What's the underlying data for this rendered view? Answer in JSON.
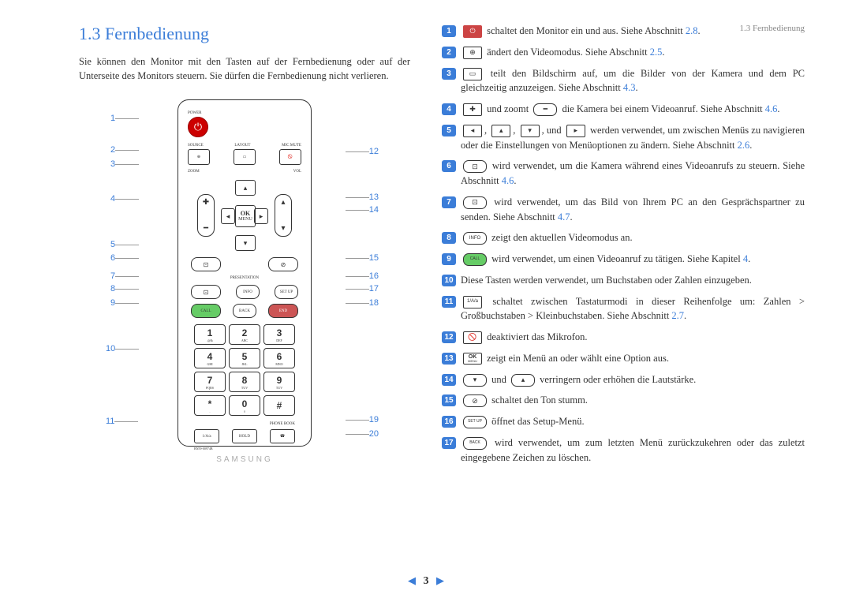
{
  "header": {
    "running": "1.3 Fernbedienung"
  },
  "heading": "1.3    Fernbedienung",
  "intro": "Sie können den Monitor mit den Tasten auf der Fernbedienung oder auf der Unterseite des Monitors steuern. Sie dürfen die Fernbedienung nicht verlieren.",
  "remote": {
    "power_label": "POWER",
    "row1": {
      "source": "SOURCE",
      "layout": "LAYOUT",
      "micmute": "MIC MUTE"
    },
    "zoom": "ZOOM",
    "vol": "VOL",
    "ok_top": "OK",
    "ok_bottom": "MENU",
    "presentation": "PRESENTATION",
    "info": "INFO",
    "setup": "SET UP",
    "call": "CALL",
    "back": "BACK",
    "end": "END",
    "keys": [
      {
        "n": "1",
        "t": ".@&"
      },
      {
        "n": "2",
        "t": "ABC"
      },
      {
        "n": "3",
        "t": "DEF"
      },
      {
        "n": "4",
        "t": "GHI"
      },
      {
        "n": "5",
        "t": "JKL"
      },
      {
        "n": "6",
        "t": "MNO"
      },
      {
        "n": "7",
        "t": "PQRS"
      },
      {
        "n": "8",
        "t": "TUV"
      },
      {
        "n": "9",
        "t": "TUV"
      },
      {
        "n": "*",
        "t": "."
      },
      {
        "n": "0",
        "t": "◊"
      },
      {
        "n": "#",
        "t": ""
      }
    ],
    "phonebook": "PHONE BOOK",
    "mode_key": "1/A/a",
    "hold": "HOLD",
    "bn": "BN59-00974B",
    "logo": "SAMSUNG"
  },
  "callouts_left": [
    "1",
    "2",
    "3",
    "4",
    "5",
    "6",
    "7",
    "8",
    "9",
    "10",
    "11"
  ],
  "callouts_right": [
    "12",
    "13",
    "14",
    "15",
    "16",
    "17",
    "18",
    "19",
    "20"
  ],
  "items": {
    "i1": {
      "icon": "⏻",
      "text": " schaltet den Monitor ein und aus. Siehe Abschnitt ",
      "link": "2.8",
      "suffix": "."
    },
    "i2": {
      "icon": "⊕",
      "text": " ändert den Videomodus. Siehe Abschnitt ",
      "link": "2.5",
      "suffix": "."
    },
    "i3": {
      "icon": "▭",
      "text": " teilt den Bildschirm auf, um die Bilder von der Kamera und dem PC gleichzeitig anzuzeigen. Siehe Abschnitt ",
      "link": "4.3",
      "suffix": "."
    },
    "i4": {
      "plus": "✚",
      "mid": " und zoomt ",
      "minus": "━",
      "text": " die Kamera bei einem Videoanruf. Siehe Abschnitt ",
      "link": "4.6",
      "suffix": "."
    },
    "i5": {
      "a1": "◂",
      "a2": "▴",
      "a3": "▾",
      "mid": ", und ",
      "a4": "▸",
      "text": " werden verwendet, um zwischen Menüs zu navigieren oder die Einstellungen von Menüoptionen zu ändern. Siehe Abschnitt ",
      "link": "2.6",
      "suffix": "."
    },
    "i6": {
      "icon": "⊡",
      "text": " wird verwendet, um die Kamera während eines Videoanrufs zu steuern. Siehe Abschnitt ",
      "link": "4.6",
      "suffix": "."
    },
    "i7": {
      "icon": "⊡",
      "text": " wird verwendet, um das Bild von Ihrem PC an den Gesprächspartner zu senden. Siehe Abschnitt ",
      "link": "4.7",
      "suffix": "."
    },
    "i8": {
      "icon": "INFO",
      "text": " zeigt den aktuellen Videomodus an."
    },
    "i9": {
      "icon": "CALL",
      "text": " wird verwendet, um einen Videoanruf zu tätigen. Siehe Kapitel ",
      "link": "4",
      "suffix": "."
    },
    "i10": {
      "text": "Diese Tasten werden verwendet, um Buchstaben oder Zahlen einzugeben."
    },
    "i11": {
      "icon": "1/A/a",
      "text": " schaltet zwischen Tastaturmodi in dieser Reihenfolge um: Zahlen > Großbuchstaben > Kleinbuchstaben. Siehe Abschnitt ",
      "link": "2.7",
      "suffix": "."
    },
    "i12": {
      "icon": "🚫",
      "text": " deaktiviert das Mikrofon."
    },
    "i13": {
      "icon": "OK",
      "sub": "MENU",
      "text": " zeigt ein Menü an oder wählt eine Option aus."
    },
    "i14": {
      "down": "▾",
      "mid": " und ",
      "up": "▴",
      "text": " verringern oder erhöhen die Lautstärke."
    },
    "i15": {
      "icon": "⊘",
      "text": " schaltet den Ton stumm."
    },
    "i16": {
      "icon": "SET UP",
      "text": " öffnet das Setup-Menü."
    },
    "i17": {
      "icon": "BACK",
      "text": " wird verwendet, um zum letzten Menü zurückzukehren oder das zuletzt eingegebene Zeichen zu löschen."
    }
  },
  "footer": {
    "page": "3"
  }
}
